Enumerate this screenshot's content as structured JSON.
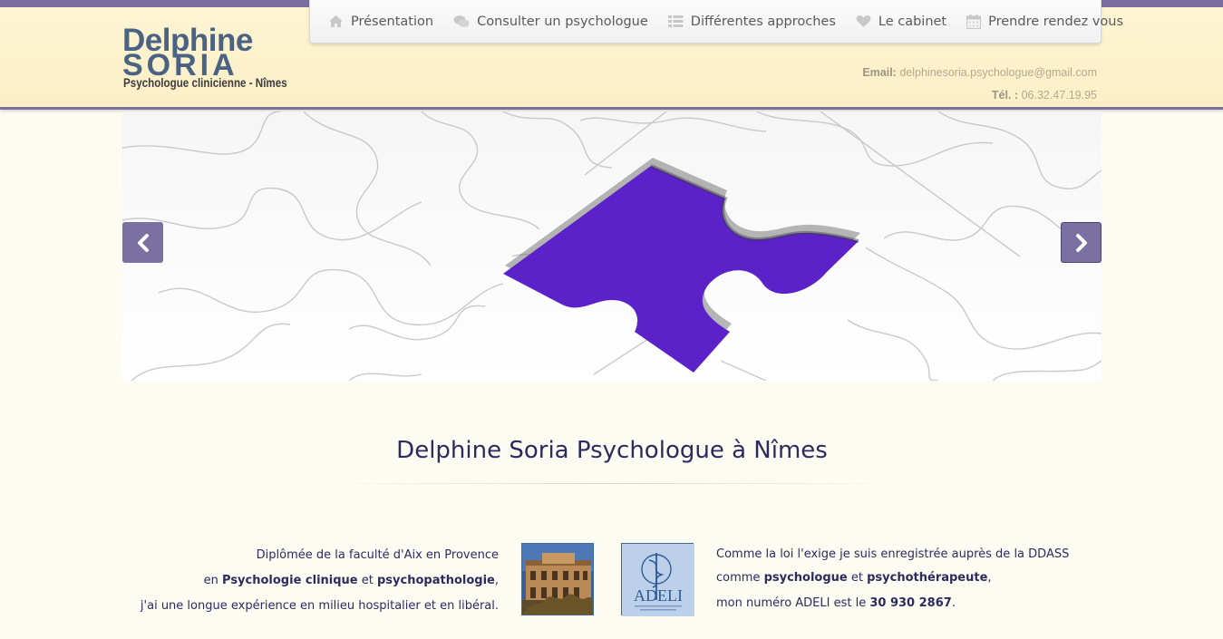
{
  "logo": {
    "line1": "Delphine",
    "line2": "SORIA",
    "line3": "Psychologue clinicienne - Nîmes"
  },
  "nav": {
    "items": [
      {
        "label": "Présentation",
        "icon": "home-icon"
      },
      {
        "label": "Consulter un psychologue",
        "icon": "chat-bubbles-icon"
      },
      {
        "label": "Différentes approches",
        "icon": "list-icon"
      },
      {
        "label": "Le cabinet",
        "icon": "heart-icon"
      },
      {
        "label": "Prendre rendez vous",
        "icon": "calendar-icon"
      }
    ]
  },
  "contact": {
    "email_label": "Email:",
    "email": "delphinesoria.psychologue@gmail.com",
    "tel_label": "Tél. :",
    "tel": "06.32.47.19.95"
  },
  "page": {
    "title": "Delphine Soria Psychologue à Nîmes"
  },
  "intro_left": {
    "line1": "Diplômée de la faculté d'Aix en Provence",
    "line2_a": "en ",
    "line2_b": "Psychologie clinique",
    "line2_c": " et ",
    "line2_d": "psychopathologie",
    "line2_e": ",",
    "line3": "j'ai une longue expérience en milieu hospitalier et en libéral."
  },
  "intro_right": {
    "line1": "Comme la loi l'exige je suis enregistrée auprès de la DDASS",
    "line2_a": "comme ",
    "line2_b": "psychologue",
    "line2_c": " et ",
    "line2_d": "psychothérapeute",
    "line2_e": ",",
    "line3_a": "mon numéro ADELI est le ",
    "line3_b": "30 930 2867",
    "line3_c": "."
  },
  "adeli_logo_text": "ADELI",
  "colors": {
    "accent": "#7a70a2",
    "header_bg": "#fdf4d2",
    "puzzle_piece": "#5a22c8",
    "title_text": "#2d2a5e"
  }
}
